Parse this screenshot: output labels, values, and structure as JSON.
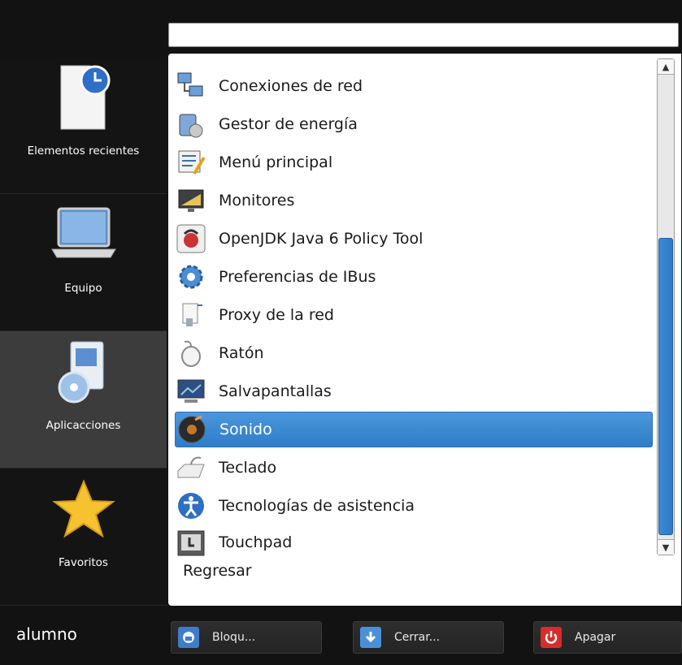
{
  "search": {
    "value": "",
    "placeholder": ""
  },
  "sidebar": {
    "items": [
      {
        "label": "Elementos recientes",
        "icon": "recent-documents-icon"
      },
      {
        "label": "Equipo",
        "icon": "computer-icon"
      },
      {
        "label": "Aplicacciones",
        "icon": "applications-icon",
        "selected": true
      },
      {
        "label": "Favoritos",
        "icon": "star-icon"
      }
    ]
  },
  "list": {
    "items": [
      {
        "label": "Conexiones de red",
        "icon": "network-connections-icon"
      },
      {
        "label": "Gestor de energía",
        "icon": "power-manager-icon"
      },
      {
        "label": "Menú principal",
        "icon": "main-menu-icon"
      },
      {
        "label": "Monitores",
        "icon": "monitor-icon"
      },
      {
        "label": "OpenJDK Java 6 Policy Tool",
        "icon": "java-icon"
      },
      {
        "label": "Preferencias de IBus",
        "icon": "gear-icon"
      },
      {
        "label": "Proxy de la red",
        "icon": "network-proxy-icon"
      },
      {
        "label": "Ratón",
        "icon": "mouse-icon"
      },
      {
        "label": "Salvapantallas",
        "icon": "screensaver-icon"
      },
      {
        "label": "Sonido",
        "icon": "sound-icon",
        "selected": true
      },
      {
        "label": "Teclado",
        "icon": "keyboard-icon"
      },
      {
        "label": "Tecnologías de asistencia",
        "icon": "accessibility-icon"
      },
      {
        "label": "Touchpad",
        "icon": "touchpad-icon"
      }
    ],
    "back_label": "Regresar"
  },
  "footer": {
    "username": "alumno",
    "buttons": [
      {
        "label": "Bloqu...",
        "icon": "lock-screen-icon"
      },
      {
        "label": "Cerrar...",
        "icon": "logout-icon"
      },
      {
        "label": "Apagar",
        "icon": "power-icon"
      }
    ]
  },
  "colors": {
    "background": "#121212",
    "selection": "#3a88d4",
    "sidebar_selected": "#3c3c3c",
    "power": "#d92b2b"
  }
}
